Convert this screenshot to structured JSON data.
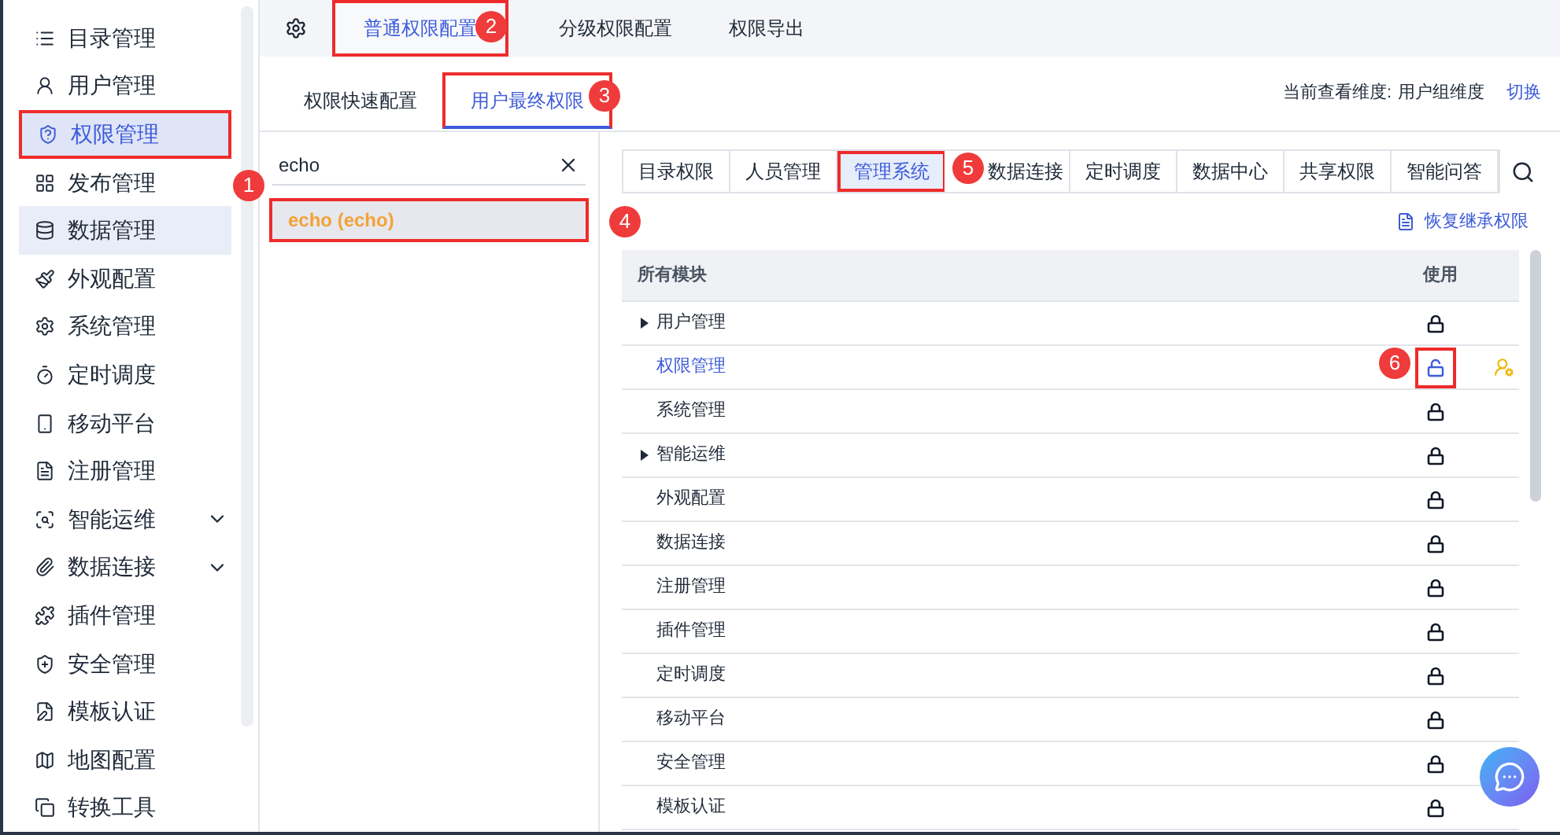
{
  "sidebar": {
    "items": [
      {
        "label": "目录管理",
        "selected": false,
        "highlighted": false,
        "expandable": false,
        "annotated": false
      },
      {
        "label": "用户管理",
        "selected": false,
        "highlighted": false,
        "expandable": false,
        "annotated": false
      },
      {
        "label": "权限管理",
        "selected": true,
        "highlighted": false,
        "expandable": false,
        "annotated": true
      },
      {
        "label": "发布管理",
        "selected": false,
        "highlighted": false,
        "expandable": false,
        "annotated": false
      },
      {
        "label": "数据管理",
        "selected": false,
        "highlighted": true,
        "expandable": false,
        "annotated": false
      },
      {
        "label": "外观配置",
        "selected": false,
        "highlighted": false,
        "expandable": false,
        "annotated": false
      },
      {
        "label": "系统管理",
        "selected": false,
        "highlighted": false,
        "expandable": false,
        "annotated": false
      },
      {
        "label": "定时调度",
        "selected": false,
        "highlighted": false,
        "expandable": false,
        "annotated": false
      },
      {
        "label": "移动平台",
        "selected": false,
        "highlighted": false,
        "expandable": false,
        "annotated": false
      },
      {
        "label": "注册管理",
        "selected": false,
        "highlighted": false,
        "expandable": false,
        "annotated": false
      },
      {
        "label": "智能运维",
        "selected": false,
        "highlighted": false,
        "expandable": true,
        "annotated": false
      },
      {
        "label": "数据连接",
        "selected": false,
        "highlighted": false,
        "expandable": true,
        "annotated": false
      },
      {
        "label": "插件管理",
        "selected": false,
        "highlighted": false,
        "expandable": false,
        "annotated": false
      },
      {
        "label": "安全管理",
        "selected": false,
        "highlighted": false,
        "expandable": false,
        "annotated": false
      },
      {
        "label": "模板认证",
        "selected": false,
        "highlighted": false,
        "expandable": false,
        "annotated": false
      },
      {
        "label": "地图配置",
        "selected": false,
        "highlighted": false,
        "expandable": false,
        "annotated": false
      },
      {
        "label": "转换工具",
        "selected": false,
        "highlighted": false,
        "expandable": false,
        "annotated": false
      }
    ]
  },
  "top_tabs": [
    {
      "label": "普通权限配置",
      "selected": true,
      "annotated": true
    },
    {
      "label": "分级权限配置",
      "selected": false,
      "annotated": false
    },
    {
      "label": "权限导出",
      "selected": false,
      "annotated": false
    }
  ],
  "sub_tabs": [
    {
      "label": "权限快速配置",
      "selected": false,
      "annotated": false
    },
    {
      "label": "用户最终权限",
      "selected": true,
      "annotated": true
    }
  ],
  "view_dimension": {
    "label": "当前查看维度:",
    "value": "用户组维度",
    "action": "切换"
  },
  "user_search": {
    "value": "echo"
  },
  "users": [
    {
      "label": "echo (echo)",
      "selected": true,
      "annotated": true
    }
  ],
  "module_tabs": [
    {
      "label": "目录权限",
      "selected": false,
      "annotated": false
    },
    {
      "label": "人员管理",
      "selected": false,
      "annotated": false
    },
    {
      "label": "管理系统",
      "selected": true,
      "annotated": true
    },
    {
      "label": "数据连接",
      "selected": false,
      "annotated": false
    },
    {
      "label": "定时调度",
      "selected": false,
      "annotated": false
    },
    {
      "label": "数据中心",
      "selected": false,
      "annotated": false
    },
    {
      "label": "共享权限",
      "selected": false,
      "annotated": false
    },
    {
      "label": "智能问答",
      "selected": false,
      "annotated": false
    }
  ],
  "restore_link": "恢复继承权限",
  "table": {
    "columns": [
      "所有模块",
      "使用"
    ],
    "rows": [
      {
        "module": "用户管理",
        "expandable": true,
        "selected": false,
        "locked": true,
        "custom": false,
        "annotated": false
      },
      {
        "module": "权限管理",
        "expandable": false,
        "selected": true,
        "locked": false,
        "custom": true,
        "annotated": true
      },
      {
        "module": "系统管理",
        "expandable": false,
        "selected": false,
        "locked": true,
        "custom": false,
        "annotated": false
      },
      {
        "module": "智能运维",
        "expandable": true,
        "selected": false,
        "locked": true,
        "custom": false,
        "annotated": false
      },
      {
        "module": "外观配置",
        "expandable": false,
        "selected": false,
        "locked": true,
        "custom": false,
        "annotated": false
      },
      {
        "module": "数据连接",
        "expandable": false,
        "selected": false,
        "locked": true,
        "custom": false,
        "annotated": false
      },
      {
        "module": "注册管理",
        "expandable": false,
        "selected": false,
        "locked": true,
        "custom": false,
        "annotated": false
      },
      {
        "module": "插件管理",
        "expandable": false,
        "selected": false,
        "locked": true,
        "custom": false,
        "annotated": false
      },
      {
        "module": "定时调度",
        "expandable": false,
        "selected": false,
        "locked": true,
        "custom": false,
        "annotated": false
      },
      {
        "module": "移动平台",
        "expandable": false,
        "selected": false,
        "locked": true,
        "custom": false,
        "annotated": false
      },
      {
        "module": "安全管理",
        "expandable": false,
        "selected": false,
        "locked": true,
        "custom": false,
        "annotated": false
      },
      {
        "module": "模板认证",
        "expandable": false,
        "selected": false,
        "locked": true,
        "custom": false,
        "annotated": false
      }
    ]
  },
  "callouts": [
    {
      "number": "1"
    },
    {
      "number": "2"
    },
    {
      "number": "3"
    },
    {
      "number": "4"
    },
    {
      "number": "5"
    },
    {
      "number": "6"
    }
  ]
}
